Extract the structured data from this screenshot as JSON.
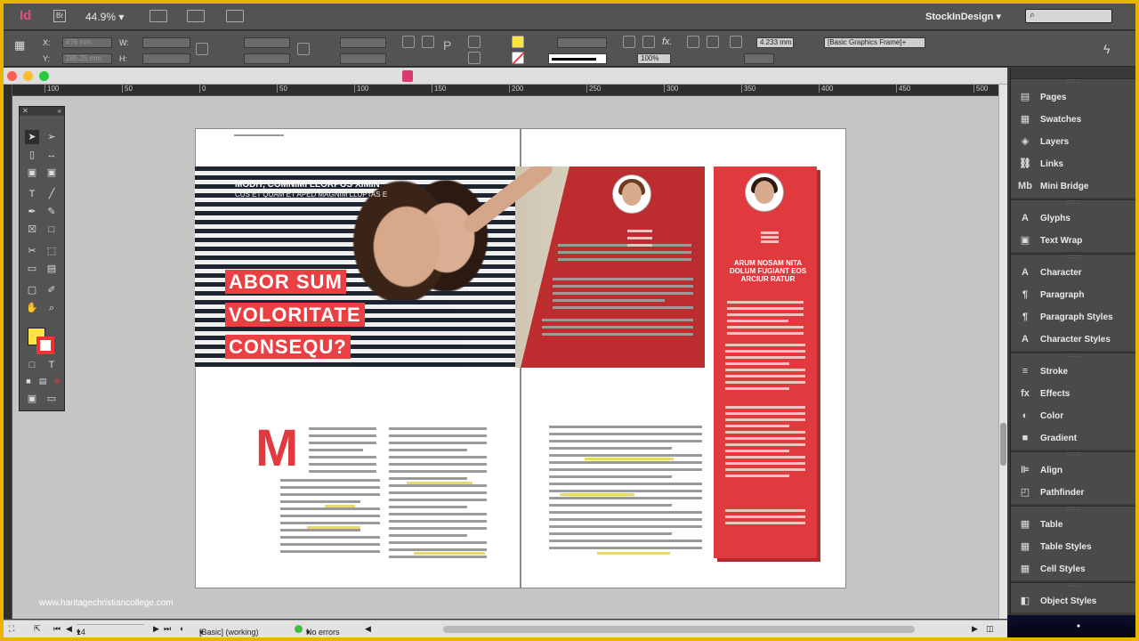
{
  "appbar": {
    "logo": "Id",
    "bridge": "Br",
    "zoom": "44.9%",
    "workspace": "StockInDesign"
  },
  "control": {
    "x_label": "X:",
    "x_value": "476 mm",
    "y_label": "Y:",
    "y_value": "285.25 mm",
    "w_label": "W:",
    "h_label": "H:",
    "stroke_weight": "4.233 mm",
    "frame_style": "[Basic Graphics Frame]+",
    "scale": "100%"
  },
  "document": {
    "subtitle_bold": "MODIT, COMNIMI LLORPOS XIMIN",
    "subtitle_small": "CUS ET QUAM ET APED MAGNIM LLUPTAS E",
    "headline": [
      "ABOR SUM",
      "VOLORITATE",
      "CONSEQU?"
    ],
    "drop_cap": "M",
    "quote": "ARUM NOSAM NITA DOLUM FUGIANT EOS ARCIUR RATUR"
  },
  "ruler": [
    "100",
    "50",
    "0",
    "50",
    "100",
    "150",
    "200",
    "250",
    "300",
    "350",
    "400",
    "450",
    "500"
  ],
  "watermark": "www.haritagechristiancollege.com",
  "panels": [
    [
      {
        "label": "Pages",
        "icon": "pages-icon",
        "glyph": "▤"
      },
      {
        "label": "Swatches",
        "icon": "swatches-icon",
        "glyph": "▦"
      },
      {
        "label": "Layers",
        "icon": "layers-icon",
        "glyph": "◈"
      },
      {
        "label": "Links",
        "icon": "links-icon",
        "glyph": "⛓"
      },
      {
        "label": "Mini Bridge",
        "icon": "mini-bridge-icon",
        "glyph": "Mb"
      }
    ],
    [
      {
        "label": "Glyphs",
        "icon": "glyphs-icon",
        "glyph": "A"
      },
      {
        "label": "Text Wrap",
        "icon": "text-wrap-icon",
        "glyph": "▣"
      }
    ],
    [
      {
        "label": "Character",
        "icon": "character-icon",
        "glyph": "A"
      },
      {
        "label": "Paragraph",
        "icon": "paragraph-icon",
        "glyph": "¶"
      },
      {
        "label": "Paragraph Styles",
        "icon": "paragraph-styles-icon",
        "glyph": "¶"
      },
      {
        "label": "Character Styles",
        "icon": "character-styles-icon",
        "glyph": "A"
      }
    ],
    [
      {
        "label": "Stroke",
        "icon": "stroke-icon",
        "glyph": "≡"
      },
      {
        "label": "Effects",
        "icon": "effects-icon",
        "glyph": "fx"
      },
      {
        "label": "Color",
        "icon": "color-icon",
        "glyph": "◐"
      },
      {
        "label": "Gradient",
        "icon": "gradient-icon",
        "glyph": "■"
      }
    ],
    [
      {
        "label": "Align",
        "icon": "align-icon",
        "glyph": "⊫"
      },
      {
        "label": "Pathfinder",
        "icon": "pathfinder-icon",
        "glyph": "◰"
      }
    ],
    [
      {
        "label": "Table",
        "icon": "table-icon",
        "glyph": "▦"
      },
      {
        "label": "Table Styles",
        "icon": "table-styles-icon",
        "glyph": "▦"
      },
      {
        "label": "Cell Styles",
        "icon": "cell-styles-icon",
        "glyph": "▦"
      }
    ],
    [
      {
        "label": "Object Styles",
        "icon": "object-styles-icon",
        "glyph": "◧"
      }
    ]
  ],
  "status": {
    "page": "14",
    "style": "[Basic] (working)",
    "errors": "No errors"
  },
  "colors": {
    "accent_red": "#e0393e",
    "fill_swatch": "#ffe445"
  }
}
